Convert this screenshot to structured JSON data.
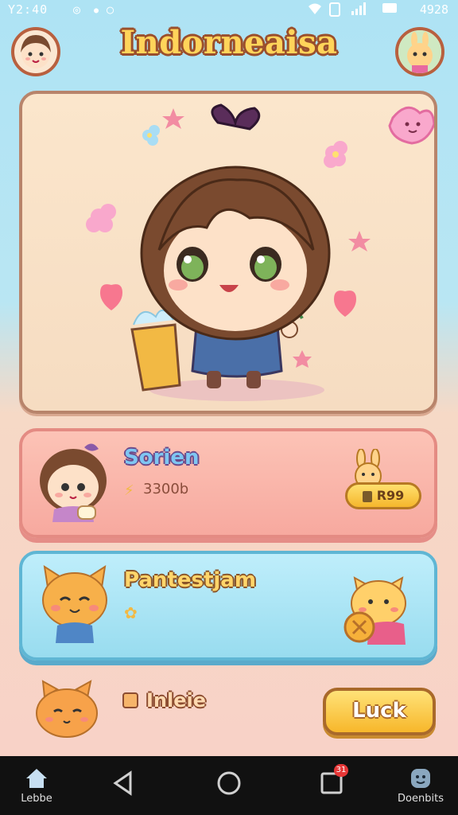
{
  "status_bar": {
    "time": "Y2:40",
    "right_text": "4928"
  },
  "header": {
    "title": "Indorneaisa",
    "left_avatar_icon": "girl-avatar-icon",
    "right_avatar_icon": "bunny-avatar-icon"
  },
  "hero": {
    "character_icon": "chibi-girl-icon",
    "decoration_icons": [
      "heart-icon",
      "flower-icon",
      "star-icon",
      "pink-bow-icon"
    ]
  },
  "cards": [
    {
      "title": "Sorien",
      "subtitle": "3300b",
      "button_label": "R99",
      "color": "#fcc3b6"
    },
    {
      "title": "Pantestjam",
      "subtitle": "",
      "color": "#bfeefb"
    }
  ],
  "bottom": {
    "label": "Inleie",
    "button_label": "Luck"
  },
  "navbar": {
    "left_label": "Lebbe",
    "right_label": "Doenbits",
    "badge_count": "31"
  },
  "colors": {
    "title_fill": "#ffd45a",
    "outline": "#9a4f2c",
    "pink_card": "#fcc3b6",
    "blue_card": "#bfeefb",
    "button_yellow": "#f5b62c"
  }
}
